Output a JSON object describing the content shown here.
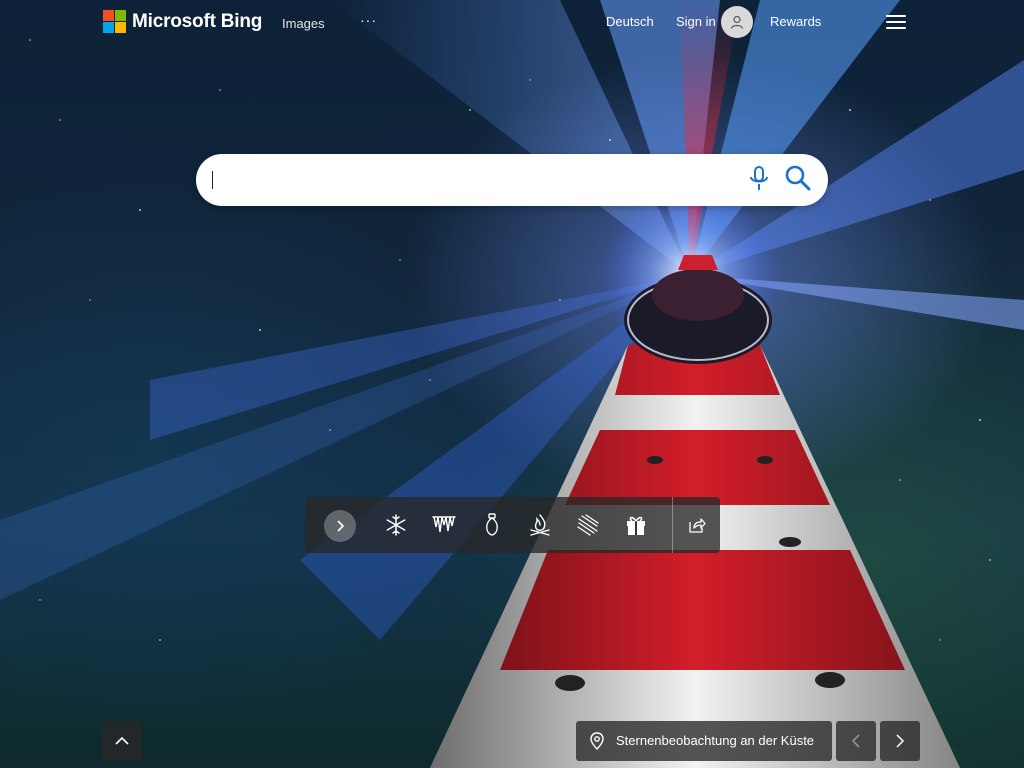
{
  "header": {
    "brand": "Microsoft Bing",
    "nav_images": "Images",
    "nav_more": "···",
    "language": "Deutsch",
    "sign_in": "Sign in",
    "rewards": "Rewards"
  },
  "search": {
    "value": "",
    "placeholder": ""
  },
  "toolbar": {
    "icons": [
      "chevron-right-icon",
      "snowflake-icon",
      "icicles-icon",
      "ornament-icon",
      "campfire-icon",
      "scarf-icon",
      "gift-icon",
      "share-icon"
    ]
  },
  "footer": {
    "location_label": "Sternenbeobachtung an der Küste"
  },
  "colors": {
    "ms_red": "#f25022",
    "ms_green": "#7fba00",
    "ms_blue": "#00a4ef",
    "ms_yellow": "#ffb900",
    "search_icon": "#1a73c8"
  }
}
